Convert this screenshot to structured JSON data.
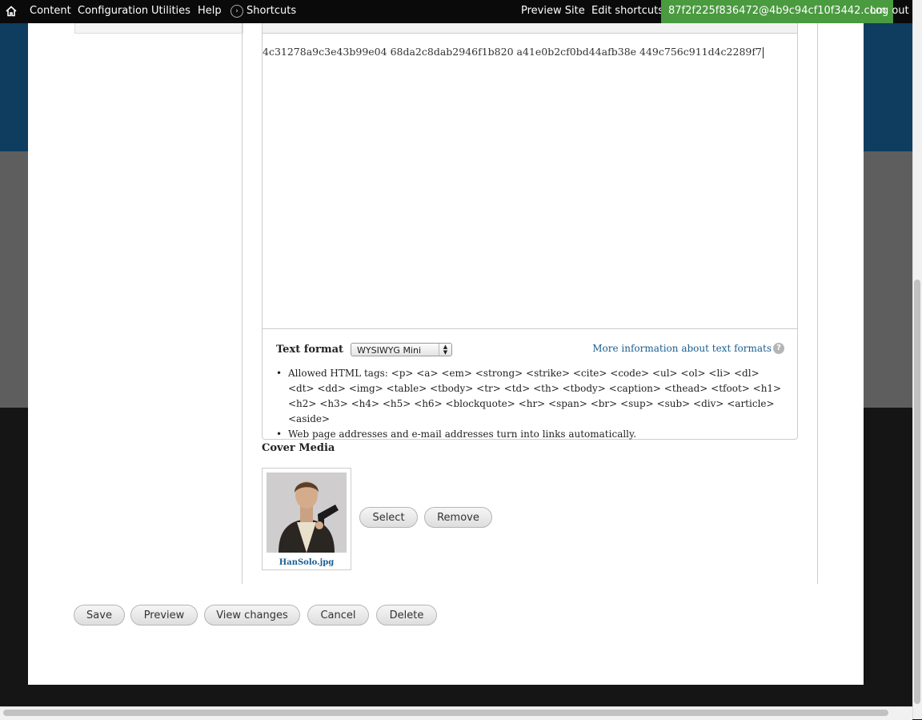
{
  "toolbar": {
    "home_icon": "home-icon",
    "menu": [
      "Content",
      "Configuration",
      "Utilities",
      "Help"
    ],
    "shortcuts_label": "Shortcuts",
    "preview_site": "Preview Site",
    "edit_shortcuts": "Edit shortcuts",
    "user_email": "87f2f225f836472@4b9c94cf10f3442.com",
    "logout": "Log out",
    "user_bg_color": "#4a9a3f"
  },
  "editor": {
    "body_text": "4c31278a9c3e43b99e04 68da2c8dab2946f1b820 a41e0b2cf0bd44afb38e 449c756c911d4c2289f7"
  },
  "text_format": {
    "label": "Text format",
    "selected": "WYSIWYG Mini",
    "more_info_link": "More information about text formats",
    "help_icon": "question-mark-icon",
    "tips": [
      "Allowed HTML tags: <p> <a> <em> <strong> <strike> <cite> <code> <ul> <ol> <li> <dl> <dt> <dd> <img> <table> <tbody> <tr> <td> <th> <tbody> <caption> <thead> <tfoot> <h1> <h2> <h3> <h4> <h5> <h6> <blockquote> <hr> <span> <br> <sup> <sub> <div> <article> <aside>",
      "Web page addresses and e-mail addresses turn into links automatically."
    ]
  },
  "cover_media": {
    "label": "Cover Media",
    "filename": "HanSolo.jpg",
    "select_button": "Select",
    "remove_button": "Remove"
  },
  "actions": {
    "save": "Save",
    "preview": "Preview",
    "view_changes": "View changes",
    "cancel": "Cancel",
    "delete": "Delete"
  }
}
